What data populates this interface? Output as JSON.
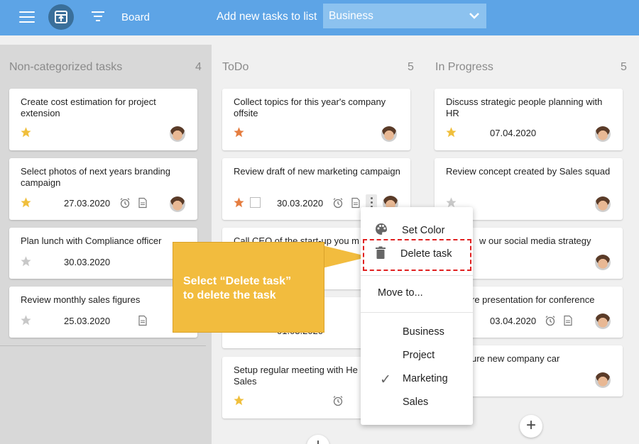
{
  "header": {
    "board_label": "Board",
    "add_new_label": "Add new tasks to list",
    "list_select_value": "Business"
  },
  "columns": [
    {
      "title": "Non-categorized tasks",
      "count": "4",
      "cards": [
        {
          "title": "Create cost estimation for project extension",
          "date": ""
        },
        {
          "title": "Select photos of next years branding campaign",
          "date": "27.03.2020"
        },
        {
          "title": "Plan lunch with Compliance officer",
          "date": "30.03.2020"
        },
        {
          "title": "Review monthly sales figures",
          "date": "25.03.2020"
        }
      ]
    },
    {
      "title": "ToDo",
      "count": "5",
      "cards": [
        {
          "title": "Collect topics for this year's company offsite",
          "date": ""
        },
        {
          "title": "Review draft of new marketing campaign",
          "date": "30.03.2020"
        },
        {
          "title": "Call CEO of the start-up you m",
          "date": ""
        },
        {
          "title": "",
          "date": "01.03.2020"
        },
        {
          "title": "Setup regular meeting with He Sales",
          "date": ""
        }
      ]
    },
    {
      "title": "In Progress",
      "count": "5",
      "cards": [
        {
          "title": "Discuss strategic people planning with HR",
          "date": "07.04.2020"
        },
        {
          "title": "Review concept created by Sales squad",
          "date": ""
        },
        {
          "title": "w our social media strategy",
          "date": ""
        },
        {
          "title": "re presentation for conference",
          "date": "03.04.2020"
        },
        {
          "title": "ure new company car",
          "date": ""
        }
      ]
    }
  ],
  "context_menu": {
    "set_color": "Set Color",
    "delete_task": "Delete task",
    "move_to": "Move to...",
    "categories": [
      "Business",
      "Project",
      "Marketing",
      "Sales"
    ],
    "checked_category": "Marketing"
  },
  "callout": {
    "line1": "Select “Delete task”",
    "line2": "to delete the task"
  },
  "add_symbol": "+",
  "check_symbol": "✓",
  "colors": {
    "topbar": "#5da4e6",
    "star_gold": "#f0bf3c",
    "star_orange": "#e57d40",
    "star_gray": "#c8c8c8",
    "callout": "#f2bc3e",
    "highlight": "#e02020"
  }
}
